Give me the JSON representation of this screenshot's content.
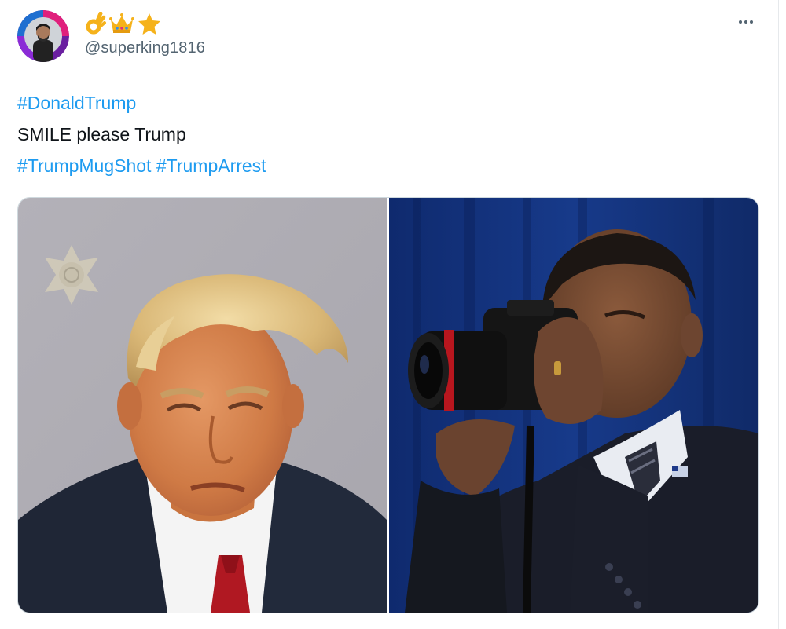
{
  "tweet": {
    "author": {
      "handle": "@superking1816",
      "display_name_emojis": [
        "ok-hand-emoji",
        "crown-emoji",
        "star-emoji"
      ]
    },
    "more_menu_icon": "more-horizontal-icon",
    "text": {
      "line1_hashtag": "#DonaldTrump",
      "line2": "SMILE please Trump",
      "line3_hashtag1": "#TrumpMugShot",
      "line3_hashtag2": "#TrumpArrest"
    },
    "media": [
      {
        "name": "photo-left",
        "kind": "mugshot photo"
      },
      {
        "name": "photo-right",
        "kind": "photographer with camera photo"
      }
    ]
  },
  "colors": {
    "link": "#1d9bf0",
    "text": "#0f1419",
    "secondary": "#536471",
    "border": "#cfd9de"
  }
}
